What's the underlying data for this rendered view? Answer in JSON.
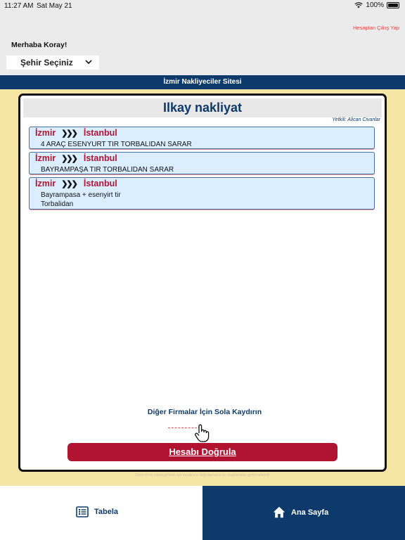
{
  "status_bar": {
    "time": "11:27 AM",
    "date": "Sat May 21",
    "battery": "100%"
  },
  "header": {
    "logout_label": "Hesaptan Çıkış Yap",
    "greeting": "Merhaba Koray!",
    "city_select": {
      "selected": "Şehir Seçiniz",
      "icon": "chevron-down-icon"
    }
  },
  "banner": {
    "title": "İzmir Nakliyeciler Sitesi"
  },
  "card": {
    "company_name": "Ilkay nakliyat",
    "authorized": "Yetkili: Alican  Civanlar",
    "routes": [
      {
        "from": "İzmir",
        "to": "İstanbul",
        "line1": "4 ARAÇ ESENYURT TIR TORBALIDAN SARAR",
        "line2": ""
      },
      {
        "from": "İzmir",
        "to": "İstanbul",
        "line1": "BAYRAMPAŞA TIR TORBALIDAN SARAR",
        "line2": ""
      },
      {
        "from": "İzmir",
        "to": "İstanbul",
        "line1": "Bayrampasa + esenyirt tir",
        "line2": "Torbalidan"
      }
    ],
    "swipe_hint": "Diğer Firmalar İçin Sola Kaydırın",
    "verify_label": "Hesabı Doğrula"
  },
  "footer_note": "Sistemimizi etkinleştirmek için hesabınızı doğrulamanız ve onaylamanız gerekmektedir",
  "tabbar": {
    "left": {
      "label": "Tabela",
      "icon": "list-icon"
    },
    "right": {
      "label": "Ana Sayfa",
      "icon": "home-icon"
    }
  },
  "colors": {
    "navy": "#0e3a6b",
    "crimson": "#b01430",
    "yellow": "#f6e6a6",
    "item_bg": "#dbeeff"
  }
}
